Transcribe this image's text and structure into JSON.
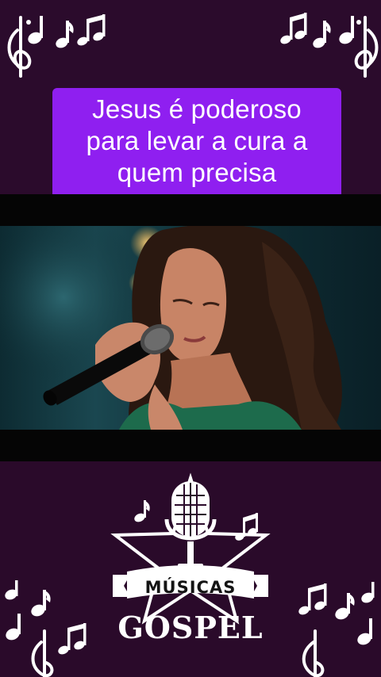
{
  "caption": {
    "lines": [
      "Jesus é poderoso",
      "para levar a cura a",
      "quem precisa"
    ],
    "background": "#8f1ff0"
  },
  "logo": {
    "line1": "MÚSICAS",
    "line2": "GOSPEL",
    "icon": "microphone-icon"
  },
  "colors": {
    "background": "#2a0a2a",
    "band": "#050505",
    "accent": "#8f1ff0"
  }
}
